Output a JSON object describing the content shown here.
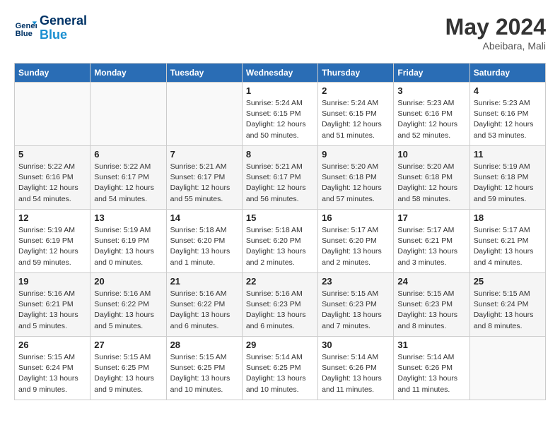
{
  "logo": {
    "text_general": "General",
    "text_blue": "Blue"
  },
  "header": {
    "month_year": "May 2024",
    "location": "Abeibara, Mali"
  },
  "days_of_week": [
    "Sunday",
    "Monday",
    "Tuesday",
    "Wednesday",
    "Thursday",
    "Friday",
    "Saturday"
  ],
  "weeks": [
    [
      {
        "day": "",
        "info": "",
        "empty": true
      },
      {
        "day": "",
        "info": "",
        "empty": true
      },
      {
        "day": "",
        "info": "",
        "empty": true
      },
      {
        "day": "1",
        "sunrise": "5:24 AM",
        "sunset": "6:15 PM",
        "daylight": "12 hours and 50 minutes.",
        "empty": false
      },
      {
        "day": "2",
        "sunrise": "5:24 AM",
        "sunset": "6:15 PM",
        "daylight": "12 hours and 51 minutes.",
        "empty": false
      },
      {
        "day": "3",
        "sunrise": "5:23 AM",
        "sunset": "6:16 PM",
        "daylight": "12 hours and 52 minutes.",
        "empty": false
      },
      {
        "day": "4",
        "sunrise": "5:23 AM",
        "sunset": "6:16 PM",
        "daylight": "12 hours and 53 minutes.",
        "empty": false
      }
    ],
    [
      {
        "day": "5",
        "sunrise": "5:22 AM",
        "sunset": "6:16 PM",
        "daylight": "12 hours and 54 minutes.",
        "empty": false
      },
      {
        "day": "6",
        "sunrise": "5:22 AM",
        "sunset": "6:17 PM",
        "daylight": "12 hours and 54 minutes.",
        "empty": false
      },
      {
        "day": "7",
        "sunrise": "5:21 AM",
        "sunset": "6:17 PM",
        "daylight": "12 hours and 55 minutes.",
        "empty": false
      },
      {
        "day": "8",
        "sunrise": "5:21 AM",
        "sunset": "6:17 PM",
        "daylight": "12 hours and 56 minutes.",
        "empty": false
      },
      {
        "day": "9",
        "sunrise": "5:20 AM",
        "sunset": "6:18 PM",
        "daylight": "12 hours and 57 minutes.",
        "empty": false
      },
      {
        "day": "10",
        "sunrise": "5:20 AM",
        "sunset": "6:18 PM",
        "daylight": "12 hours and 58 minutes.",
        "empty": false
      },
      {
        "day": "11",
        "sunrise": "5:19 AM",
        "sunset": "6:18 PM",
        "daylight": "12 hours and 59 minutes.",
        "empty": false
      }
    ],
    [
      {
        "day": "12",
        "sunrise": "5:19 AM",
        "sunset": "6:19 PM",
        "daylight": "12 hours and 59 minutes.",
        "empty": false
      },
      {
        "day": "13",
        "sunrise": "5:19 AM",
        "sunset": "6:19 PM",
        "daylight": "13 hours and 0 minutes.",
        "empty": false
      },
      {
        "day": "14",
        "sunrise": "5:18 AM",
        "sunset": "6:20 PM",
        "daylight": "13 hours and 1 minute.",
        "empty": false
      },
      {
        "day": "15",
        "sunrise": "5:18 AM",
        "sunset": "6:20 PM",
        "daylight": "13 hours and 2 minutes.",
        "empty": false
      },
      {
        "day": "16",
        "sunrise": "5:17 AM",
        "sunset": "6:20 PM",
        "daylight": "13 hours and 2 minutes.",
        "empty": false
      },
      {
        "day": "17",
        "sunrise": "5:17 AM",
        "sunset": "6:21 PM",
        "daylight": "13 hours and 3 minutes.",
        "empty": false
      },
      {
        "day": "18",
        "sunrise": "5:17 AM",
        "sunset": "6:21 PM",
        "daylight": "13 hours and 4 minutes.",
        "empty": false
      }
    ],
    [
      {
        "day": "19",
        "sunrise": "5:16 AM",
        "sunset": "6:21 PM",
        "daylight": "13 hours and 5 minutes.",
        "empty": false
      },
      {
        "day": "20",
        "sunrise": "5:16 AM",
        "sunset": "6:22 PM",
        "daylight": "13 hours and 5 minutes.",
        "empty": false
      },
      {
        "day": "21",
        "sunrise": "5:16 AM",
        "sunset": "6:22 PM",
        "daylight": "13 hours and 6 minutes.",
        "empty": false
      },
      {
        "day": "22",
        "sunrise": "5:16 AM",
        "sunset": "6:23 PM",
        "daylight": "13 hours and 6 minutes.",
        "empty": false
      },
      {
        "day": "23",
        "sunrise": "5:15 AM",
        "sunset": "6:23 PM",
        "daylight": "13 hours and 7 minutes.",
        "empty": false
      },
      {
        "day": "24",
        "sunrise": "5:15 AM",
        "sunset": "6:23 PM",
        "daylight": "13 hours and 8 minutes.",
        "empty": false
      },
      {
        "day": "25",
        "sunrise": "5:15 AM",
        "sunset": "6:24 PM",
        "daylight": "13 hours and 8 minutes.",
        "empty": false
      }
    ],
    [
      {
        "day": "26",
        "sunrise": "5:15 AM",
        "sunset": "6:24 PM",
        "daylight": "13 hours and 9 minutes.",
        "empty": false
      },
      {
        "day": "27",
        "sunrise": "5:15 AM",
        "sunset": "6:25 PM",
        "daylight": "13 hours and 9 minutes.",
        "empty": false
      },
      {
        "day": "28",
        "sunrise": "5:15 AM",
        "sunset": "6:25 PM",
        "daylight": "13 hours and 10 minutes.",
        "empty": false
      },
      {
        "day": "29",
        "sunrise": "5:14 AM",
        "sunset": "6:25 PM",
        "daylight": "13 hours and 10 minutes.",
        "empty": false
      },
      {
        "day": "30",
        "sunrise": "5:14 AM",
        "sunset": "6:26 PM",
        "daylight": "13 hours and 11 minutes.",
        "empty": false
      },
      {
        "day": "31",
        "sunrise": "5:14 AM",
        "sunset": "6:26 PM",
        "daylight": "13 hours and 11 minutes.",
        "empty": false
      },
      {
        "day": "",
        "info": "",
        "empty": true
      }
    ]
  ]
}
